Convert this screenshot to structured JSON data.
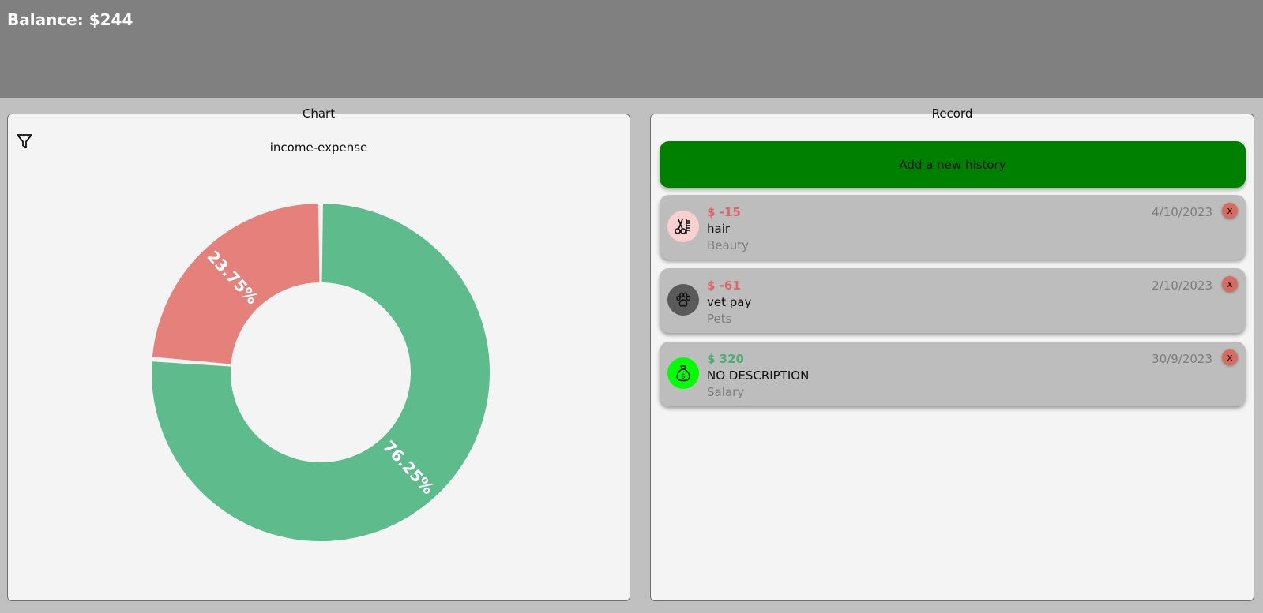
{
  "header": {
    "balance": "Balance: $244"
  },
  "chart_panel": {
    "legend": "Chart",
    "filter_icon": "filter-funnel-icon"
  },
  "record_panel": {
    "legend": "Record",
    "add_label": "Add a new history"
  },
  "chart_data": {
    "type": "pie",
    "title": "income-expense",
    "donut": true,
    "slices": [
      {
        "label": "76.25%",
        "value": 76.25,
        "color": "#5dbb8c"
      },
      {
        "label": "23.75%",
        "value": 23.75,
        "color": "#e5807a"
      }
    ]
  },
  "records": [
    {
      "amount": "$ -15",
      "amount_color": "#e06666",
      "description": "hair",
      "category": "Beauty",
      "date": "4/10/2023",
      "icon": "scissors-comb-icon",
      "icon_bg": "#f8d0d0",
      "delete_label": "x"
    },
    {
      "amount": "$ -61",
      "amount_color": "#e06666",
      "description": "vet pay",
      "category": "Pets",
      "date": "2/10/2023",
      "icon": "paw-icon",
      "icon_bg": "#5a5a5a",
      "delete_label": "x"
    },
    {
      "amount": "$ 320",
      "amount_color": "#4caf72",
      "description": "NO DESCRIPTION",
      "category": "Salary",
      "date": "30/9/2023",
      "icon": "money-bag-icon",
      "icon_bg": "#00ff00",
      "delete_label": "x"
    }
  ]
}
